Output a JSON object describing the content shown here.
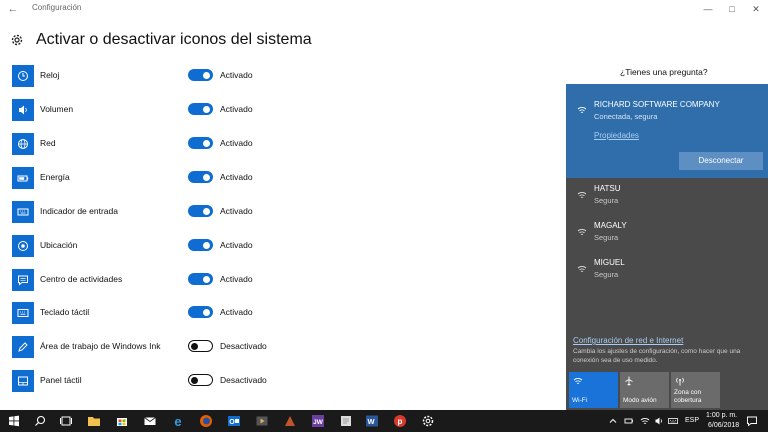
{
  "window": {
    "title": "Configuración"
  },
  "page": {
    "title": "Activar o desactivar iconos del sistema"
  },
  "settings": [
    {
      "label": "Reloj",
      "state": "Activado",
      "on": true,
      "icon": "clock-icon"
    },
    {
      "label": "Volumen",
      "state": "Activado",
      "on": true,
      "icon": "volume-icon"
    },
    {
      "label": "Red",
      "state": "Activado",
      "on": true,
      "icon": "globe-icon"
    },
    {
      "label": "Energía",
      "state": "Activado",
      "on": true,
      "icon": "battery-icon"
    },
    {
      "label": "Indicador de entrada",
      "state": "Activado",
      "on": true,
      "icon": "keyboard-icon"
    },
    {
      "label": "Ubicación",
      "state": "Activado",
      "on": true,
      "icon": "location-icon"
    },
    {
      "label": "Centro de actividades",
      "state": "Activado",
      "on": true,
      "icon": "action-center-icon"
    },
    {
      "label": "Teclado táctil",
      "state": "Activado",
      "on": true,
      "icon": "touch-keyboard-icon"
    },
    {
      "label": "Área de trabajo de Windows Ink",
      "state": "Desactivado",
      "on": false,
      "icon": "pen-icon"
    },
    {
      "label": "Panel táctil",
      "state": "Desactivado",
      "on": false,
      "icon": "touchpad-icon"
    }
  ],
  "help": {
    "question": "¿Tienes una pregunta?"
  },
  "network": {
    "connected": {
      "name": "RICHARD SOFTWARE COMPANY",
      "status": "Conectada, segura",
      "properties": "Propiedades",
      "disconnect": "Desconectar"
    },
    "others": [
      {
        "name": "HATSU",
        "status": "Segura"
      },
      {
        "name": "MAGALY",
        "status": "Segura"
      },
      {
        "name": "MIGUEL",
        "status": "Segura"
      }
    ],
    "settings_link": "Configuración de red e Internet",
    "settings_desc": "Cambia los ajustes de configuración, como hacer que una conexión sea de uso medido.",
    "quick_actions": [
      {
        "label": "Wi-Fi",
        "active": true
      },
      {
        "label": "Modo avión",
        "active": false
      },
      {
        "label": "Zona con cobertura",
        "active": false
      }
    ]
  },
  "taskbar": {
    "language": "ESP",
    "time": "1:00 p. m.",
    "date": "6/06/2018"
  },
  "colors": {
    "accent": "#0f6cd0",
    "flyout_bg": "#4a4a4a",
    "flyout_active": "#2f6eab",
    "taskbar_bg": "#1a1a1a"
  }
}
